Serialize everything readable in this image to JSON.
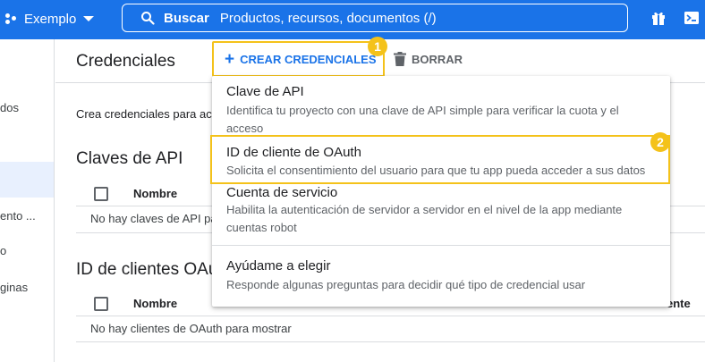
{
  "topbar": {
    "project_name": "Exemplo",
    "search_label": "Buscar",
    "search_placeholder": "Productos, recursos, documentos (/)",
    "accent_color": "#1a73e8"
  },
  "leftnav": {
    "items": [
      "dos",
      "ento ...",
      "o",
      "ginas"
    ]
  },
  "header": {
    "title": "Credenciales",
    "create_label": "CREAR CREDENCIALES",
    "delete_label": "BORRAR",
    "badge1": "1",
    "badge2": "2",
    "badge_color": "#f4c21a"
  },
  "main": {
    "description": "Crea credenciales para acce",
    "api_keys": {
      "title": "Claves de API",
      "column_name": "Nombre",
      "empty_text": "No hay claves de API pa"
    },
    "oauth_clients": {
      "title": "ID de clientes OAut",
      "column_name": "Nombre",
      "column_extra": "ente",
      "empty_text": "No hay clientes de OAuth para mostrar"
    }
  },
  "menu": {
    "items": [
      {
        "title": "Clave de API",
        "subtitle": "Identifica tu proyecto con una clave de API simple para verificar la cuota y el acceso"
      },
      {
        "title": "ID de cliente de OAuth",
        "subtitle": "Solicita el consentimiento del usuario para que tu app pueda acceder a sus datos"
      },
      {
        "title": "Cuenta de servicio",
        "subtitle": "Habilita la autenticación de servidor a servidor en el nivel de la app mediante cuentas robot"
      },
      {
        "title": "Ayúdame a elegir",
        "subtitle": "Responde algunas preguntas para decidir qué tipo de credencial usar"
      }
    ]
  }
}
